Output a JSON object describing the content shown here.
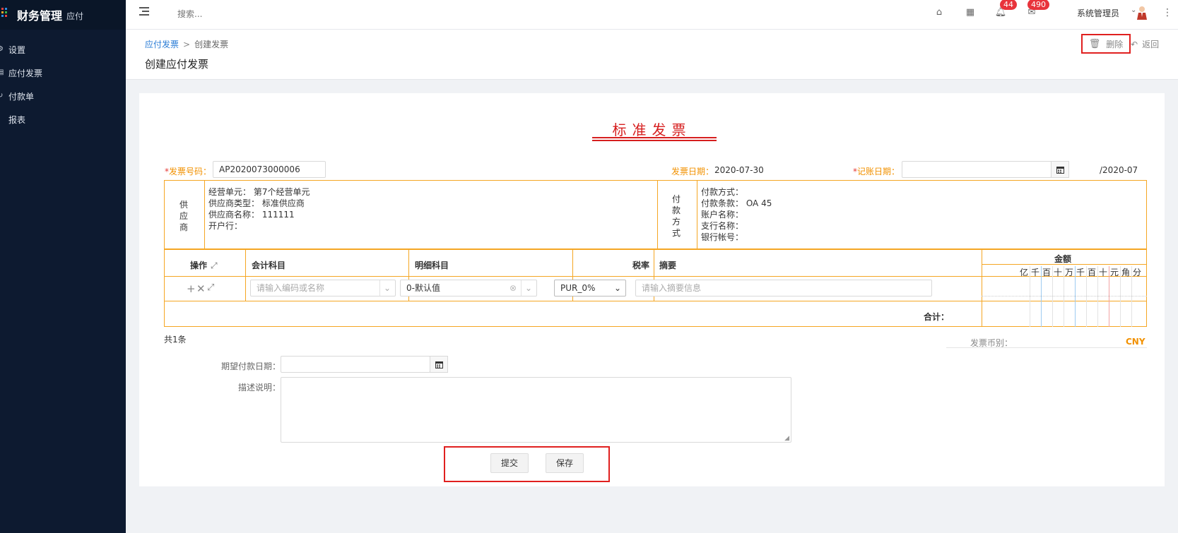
{
  "app": {
    "title": "财务管理",
    "subtitle": "应付"
  },
  "sidebar": {
    "items": [
      {
        "label": "设置",
        "icon": "gear-icon"
      },
      {
        "label": "应付发票",
        "icon": "invoice-icon"
      },
      {
        "label": "付款单",
        "icon": "payment-icon"
      },
      {
        "label": "报表",
        "icon": "chart-icon"
      }
    ]
  },
  "topbar": {
    "search_placeholder": "搜索...",
    "notifications_count": "44",
    "messages_count": "490",
    "user_name": "系统管理员"
  },
  "header": {
    "breadcrumb_link": "应付发票",
    "breadcrumb_sep": ">",
    "breadcrumb_current": "创建发票",
    "page_title": "创建应付发票",
    "delete_label": "删除",
    "back_label": "返回"
  },
  "invoice": {
    "title": "标准发票",
    "invoice_no_label": "发票号码：",
    "invoice_no_value": "AP2020073000006",
    "invoice_date_label": "发票日期：",
    "invoice_date_value": "2020-07-30",
    "post_date_label": "记账日期：",
    "post_date_value": "",
    "period_value": "/2020-07",
    "supplier_label": [
      "供",
      "应",
      "商"
    ],
    "supplier_info": [
      "经营单元：  第7个经营单元",
      "供应商类型：  标准供应商",
      "供应商名称：  111111",
      "开户行："
    ],
    "payment_label": [
      "付",
      "款",
      "方",
      "式"
    ],
    "payment_info": [
      "付款方式：",
      "付款条款：  OA 45",
      "账户名称：",
      "支行名称：",
      "银行帐号："
    ]
  },
  "lines_table": {
    "headers": {
      "op": "操作",
      "account": "会计科目",
      "detail": "明细科目",
      "tax": "税率",
      "summary": "摘要",
      "amount": "金额"
    },
    "digits": [
      "亿",
      "千",
      "百",
      "十",
      "万",
      "千",
      "百",
      "十",
      "元",
      "角",
      "分"
    ],
    "row": {
      "account_placeholder": "请输入编码或名称",
      "detail_value": "0-默认值",
      "tax_value": "PUR_0%",
      "summary_placeholder": "请输入摘要信息"
    },
    "total_label": "合计："
  },
  "footer": {
    "count_label": "共1条",
    "currency_label": "发票币别：",
    "currency_value": "CNY",
    "expected_date_label": "期望付款日期：",
    "description_label": "描述说明：",
    "submit_label": "提交",
    "save_label": "保存"
  },
  "colors": {
    "accent": "#f29100",
    "title_red": "#d61f1f",
    "highlight": "#e0201f",
    "sidebar": "#0d1a30",
    "link": "#2a7cd6"
  }
}
